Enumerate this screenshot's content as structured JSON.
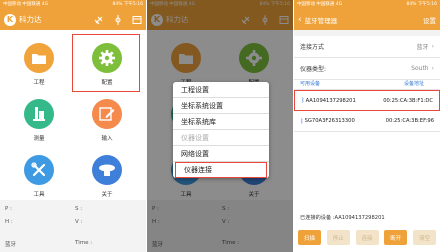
{
  "status": {
    "left": "中国移动 中国联通 4G",
    "right1": "84% 下午5:16",
    "right2": "84% 下午5:16",
    "right3": "84% 下午5:16"
  },
  "app": {
    "brand": "科力达",
    "logo_char": "K"
  },
  "home": {
    "tiles": [
      {
        "label": "工程",
        "color": "#f1a33c"
      },
      {
        "label": "配置",
        "color": "#7dbf3b"
      },
      {
        "label": "测量",
        "color": "#35b88a"
      },
      {
        "label": "输入",
        "color": "#f48a4c"
      },
      {
        "label": "工具",
        "color": "#3e9ae2"
      },
      {
        "label": "关于",
        "color": "#3e7fd9"
      }
    ],
    "info": {
      "p": "P :",
      "s": "S :",
      "h": "H :",
      "v": "V :",
      "bluetooth": "蓝牙",
      "time": "Time :"
    }
  },
  "config_menu": {
    "items": [
      {
        "label": "工程设置",
        "state": "normal"
      },
      {
        "label": "坐标系统设置",
        "state": "normal"
      },
      {
        "label": "坐标系统库",
        "state": "normal"
      },
      {
        "label": "仪器设置",
        "state": "disabled"
      },
      {
        "label": "网络设置",
        "state": "normal"
      },
      {
        "label": "仪器连接",
        "state": "selected"
      }
    ]
  },
  "bt_manager": {
    "title": "蓝牙管理器",
    "settings": "设置",
    "connection_label": "连接方式",
    "connection_value": "蓝牙",
    "instrument_label": "仪器类型:",
    "instrument_value": "South",
    "col_device": "可用设备",
    "col_address": "设备地址",
    "devices": [
      {
        "name": "AA1094137298201",
        "address": "00:25:CA:3B:F1:DC",
        "selected": true
      },
      {
        "name": "SG70A3F26313300",
        "address": "00:25:CA:3B:EF:96",
        "selected": false
      }
    ],
    "connected_label": "已连接的设备 :AA1094137298201",
    "buttons": [
      "扫描",
      "停止",
      "连接",
      "断开",
      "清空"
    ]
  }
}
